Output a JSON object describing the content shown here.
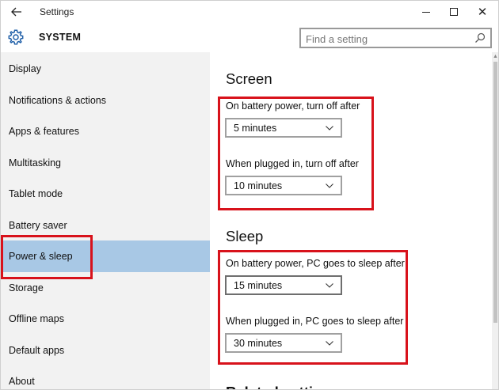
{
  "window": {
    "app_title": "Settings",
    "section_title": "SYSTEM",
    "controls": {
      "minimize": "minimize-icon",
      "maximize": "maximize-icon",
      "close": "close-icon"
    }
  },
  "search": {
    "placeholder": "Find a setting",
    "value": ""
  },
  "sidebar": {
    "selected": "Power & sleep",
    "items": [
      {
        "label": "Display"
      },
      {
        "label": "Notifications & actions"
      },
      {
        "label": "Apps & features"
      },
      {
        "label": "Multitasking"
      },
      {
        "label": "Tablet mode"
      },
      {
        "label": "Battery saver"
      },
      {
        "label": "Power & sleep"
      },
      {
        "label": "Storage"
      },
      {
        "label": "Offline maps"
      },
      {
        "label": "Default apps"
      },
      {
        "label": "About"
      }
    ]
  },
  "screen": {
    "heading": "Screen",
    "battery_label": "On battery power, turn off after",
    "battery_value": "5 minutes",
    "plugged_label": "When plugged in, turn off after",
    "plugged_value": "10 minutes"
  },
  "sleep": {
    "heading": "Sleep",
    "battery_label": "On battery power, PC goes to sleep after",
    "battery_value": "15 minutes",
    "plugged_label": "When plugged in, PC goes to sleep after",
    "plugged_value": "30 minutes"
  },
  "related": {
    "heading_partial": "Related settings"
  },
  "colors": {
    "selection": "#a8c8e5",
    "highlight_box": "#d8121b",
    "sidebar_bg": "#f2f2f2"
  }
}
